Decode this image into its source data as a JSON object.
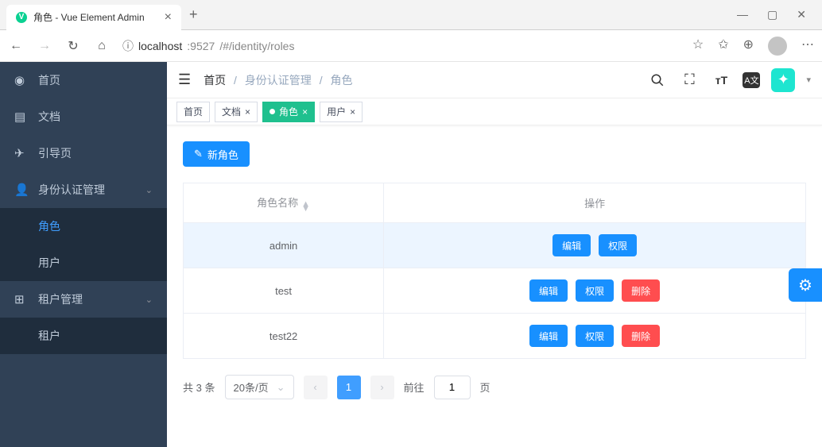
{
  "browser": {
    "tab_title": "角色 - Vue Element Admin",
    "url_host": "localhost",
    "url_port": ":9527",
    "url_path": "/#/identity/roles"
  },
  "sidebar": {
    "items": [
      {
        "icon": "⊙",
        "label": "首页"
      },
      {
        "icon": "🖹",
        "label": "文档"
      },
      {
        "icon": "✈",
        "label": "引导页"
      },
      {
        "icon": "👤",
        "label": "身份认证管理",
        "expandable": true
      },
      {
        "icon": "",
        "label": "角色",
        "sub": true,
        "active": true
      },
      {
        "icon": "",
        "label": "用户",
        "sub": true
      },
      {
        "icon": "⊞",
        "label": "租户管理",
        "expandable": true
      },
      {
        "icon": "",
        "label": "租户",
        "sub": true
      }
    ]
  },
  "breadcrumb": {
    "items": [
      "首页",
      "身份认证管理",
      "角色"
    ]
  },
  "tags": [
    {
      "label": "首页",
      "active": false,
      "closable": false
    },
    {
      "label": "文档",
      "active": false,
      "closable": true
    },
    {
      "label": "角色",
      "active": true,
      "closable": true
    },
    {
      "label": "用户",
      "active": false,
      "closable": true
    }
  ],
  "toolbar": {
    "new_role": "新角色"
  },
  "table": {
    "columns": {
      "name": "角色名称",
      "action": "操作"
    },
    "actions": {
      "edit": "编辑",
      "perm": "权限",
      "delete": "删除"
    },
    "rows": [
      {
        "name": "admin",
        "deletable": false,
        "hover": true
      },
      {
        "name": "test",
        "deletable": true
      },
      {
        "name": "test22",
        "deletable": true
      }
    ]
  },
  "pagination": {
    "total_prefix": "共",
    "total_count": "3",
    "total_suffix": "条",
    "page_size": "20条/页",
    "current": "1",
    "goto_prefix": "前往",
    "goto_value": "1",
    "goto_suffix": "页"
  },
  "nav_icons": {
    "lang": "A文"
  }
}
